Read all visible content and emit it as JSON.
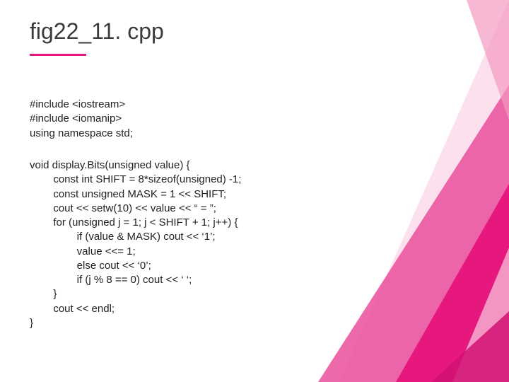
{
  "title": "fig22_11. cpp",
  "includes": "#include <iostream>\n#include <iomanip>\nusing namespace std;",
  "code": "void display.Bits(unsigned value) {\n        const int SHIFT = 8*sizeof(unsigned) -1;\n        const unsigned MASK = 1 << SHIFT;\n        cout << setw(10) << value << “ = ”;\n        for (unsigned j = 1; j < SHIFT + 1; j++) {\n                if (value & MASK) cout << ‘1’;\n                value <<= 1;\n                else cout << ‘0’;\n                if (j % 8 == 0) cout << ‘ ‘;\n        }\n        cout << endl;\n}"
}
